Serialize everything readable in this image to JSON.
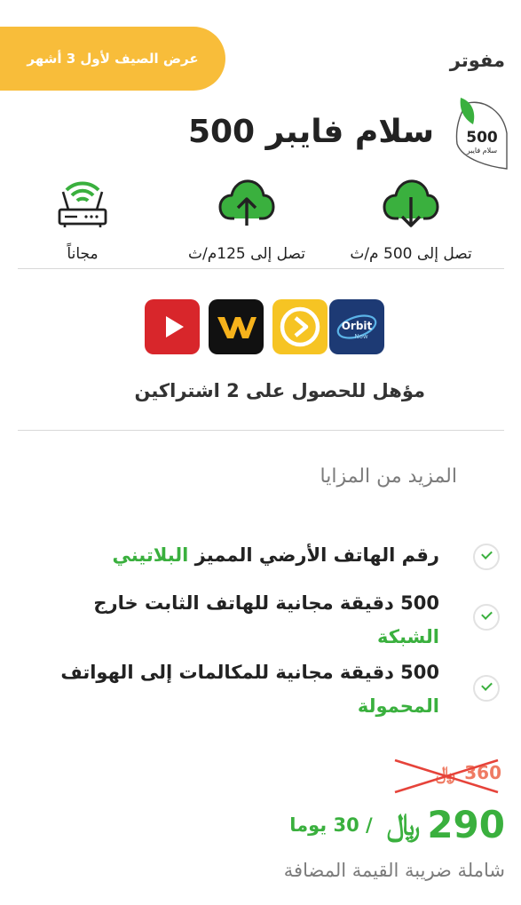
{
  "promo": {
    "label": "عرض الصيف لأول 3 أشهر"
  },
  "plan": {
    "type_label": "مفوتر",
    "title": "سلام فايبر 500",
    "logo": {
      "number": "500",
      "caption": "سلام فايبر"
    }
  },
  "features": [
    {
      "icon": "cloud-download-icon",
      "label": "تصل إلى 500 م/ث"
    },
    {
      "icon": "cloud-upload-icon",
      "label": "تصل إلى 125م/ث"
    },
    {
      "icon": "wifi-router-icon",
      "label": "مجاناً"
    }
  ],
  "apps": [
    {
      "icon": "orbit-now-icon",
      "text": "Orbit",
      "sub": "Now"
    },
    {
      "icon": "play-app-icon"
    },
    {
      "icon": "wavo-app-icon"
    },
    {
      "icon": "youtube-icon"
    }
  ],
  "eligibility": "مؤهل للحصول على 2 اشتراكين",
  "more_benefits": {
    "title": "المزيد من المزايا",
    "items": [
      {
        "text": "رقم الهاتف الأرضي المميز ",
        "highlight": "البلاتيني"
      },
      {
        "text": "500 دقيقة مجانية للهاتف الثابت خارج ",
        "highlight": "الشبكة"
      },
      {
        "text": "500 دقيقة مجانية للمكالمات إلى الهواتف ",
        "highlight": "المحمولة"
      }
    ]
  },
  "pricing": {
    "old_price": "360",
    "old_currency": "﷼",
    "price": "290",
    "currency": "﷼",
    "period": "/ 30 يوما",
    "vat_note": "شاملة ضريبة القيمة المضافة"
  },
  "colors": {
    "brand_green": "#3ab03e",
    "promo_yellow": "#f8bd3a",
    "old_price": "#ef7b63"
  }
}
